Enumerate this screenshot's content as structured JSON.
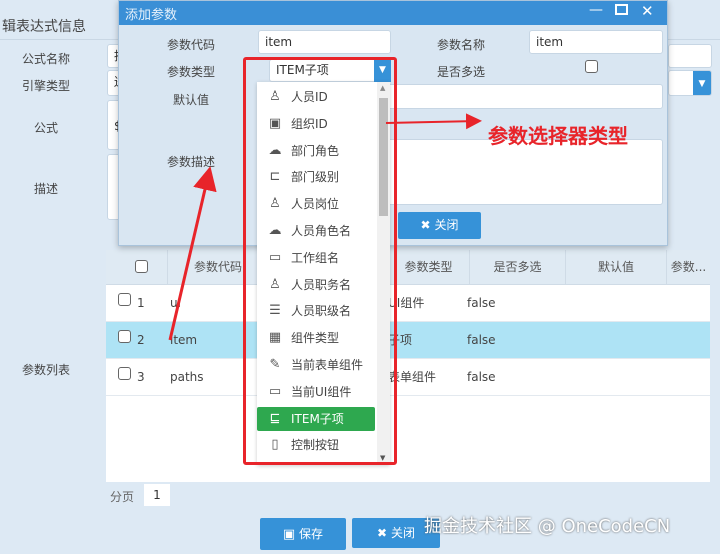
{
  "background": {
    "title": "辑表达式信息",
    "labels": {
      "formula_name": "公式名称",
      "engine_type": "引擎类型",
      "formula": "公式",
      "description": "描述",
      "param_list": "参数列表"
    },
    "partial_values": {
      "formula_name": "揺",
      "engine_type": "逬",
      "formula": "$"
    }
  },
  "table": {
    "headers": [
      "参数代码",
      "参数类型",
      "是否多选",
      "默认值",
      "参数..."
    ],
    "rows": [
      {
        "num": "1",
        "code": "ui",
        "type": "UI组件",
        "multi": "false",
        "selected": false
      },
      {
        "num": "2",
        "code": "item",
        "type": "子项",
        "multi": "false",
        "selected": true
      },
      {
        "num": "3",
        "code": "paths",
        "type": "表单组件",
        "multi": "false",
        "selected": false
      }
    ]
  },
  "pager": {
    "label": "分页",
    "page": "1"
  },
  "footer": {
    "save": "保存",
    "close": "关闭"
  },
  "dialog": {
    "title": "添加参数",
    "code_label": "参数代码",
    "code_value": "item",
    "name_label": "参数名称",
    "name_value": "item",
    "type_label": "参数类型",
    "type_value": "ITEM子项",
    "multi_label": "是否多选",
    "default_label": "默认值",
    "desc_label": "参数描述",
    "close": "关闭"
  },
  "dropdown": {
    "items": [
      {
        "label": "人员ID",
        "icon": "user-icon"
      },
      {
        "label": "组织ID",
        "icon": "org-icon"
      },
      {
        "label": "部门角色",
        "icon": "cloud-group-icon"
      },
      {
        "label": "部门级别",
        "icon": "hierarchy-icon"
      },
      {
        "label": "人员岗位",
        "icon": "user-icon"
      },
      {
        "label": "人员角色名",
        "icon": "cloud-group-icon"
      },
      {
        "label": "工作组名",
        "icon": "window-icon"
      },
      {
        "label": "人员职务名",
        "icon": "user-card-icon"
      },
      {
        "label": "人员职级名",
        "icon": "list-icon"
      },
      {
        "label": "组件类型",
        "icon": "grid-icon"
      },
      {
        "label": "当前表单组件",
        "icon": "form-edit-icon"
      },
      {
        "label": "当前UI组件",
        "icon": "window-icon"
      },
      {
        "label": "ITEM子项",
        "icon": "tree-item-icon",
        "selected": true
      },
      {
        "label": "控制按钮",
        "icon": "button-icon"
      }
    ]
  },
  "annotation": {
    "text": "参数选择器类型",
    "color": "#e8242a"
  },
  "watermark": "掘金技术社区 @ OneCodeCN",
  "colors": {
    "accent": "#3692d8",
    "selected_item": "#2ea84f",
    "selected_row": "#aee3f5"
  }
}
